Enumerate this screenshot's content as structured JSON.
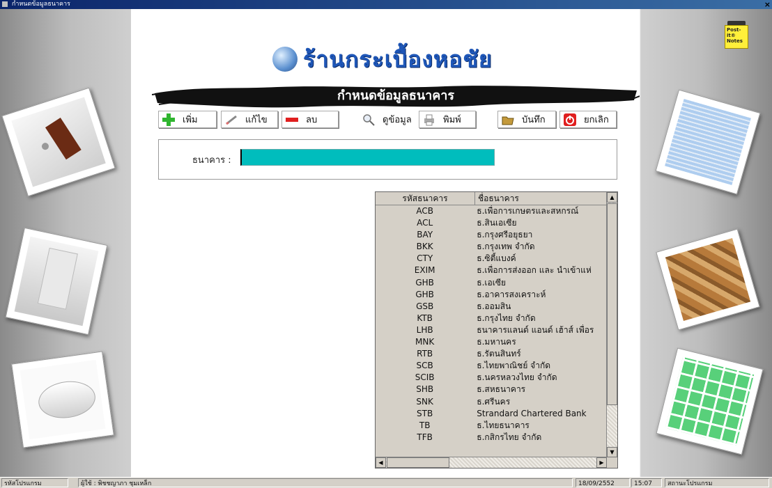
{
  "window": {
    "title": "กำหนดข้อมูลธนาคาร",
    "close_glyph": "×"
  },
  "logo": {
    "shop_name": "ร้านกระเบื้องหอชัย"
  },
  "banner": {
    "title": "กำหนดข้อมูลธนาคาร"
  },
  "toolbar": {
    "add": "เพิ่ม",
    "edit": "แก้ไข",
    "delete": "ลบ",
    "view": "ดูข้อมูล",
    "print": "พิมพ์",
    "save": "บันทึก",
    "cancel": "ยกเลิก"
  },
  "form": {
    "bank_label": "ธนาคาร :",
    "bank_value": ""
  },
  "grid": {
    "columns": [
      "รหัสธนาคาร",
      "ชื่อธนาคาร"
    ],
    "rows": [
      [
        "ACB",
        "ธ.เพื่อการเกษตรและสหกรณ์"
      ],
      [
        "ACL",
        "ธ.สินเอเซีย"
      ],
      [
        "BAY",
        "ธ.กรุงศรีอยุธยา"
      ],
      [
        "BKK",
        "ธ.กรุงเทพ จำกัด"
      ],
      [
        "CTY",
        "ธ.ซิตี้แบงค์"
      ],
      [
        "EXIM",
        "ธ.เพื่อการส่งออก และ นำเข้าแห่"
      ],
      [
        "GHB",
        "ธ.เอเซีย"
      ],
      [
        "GHB",
        "ธ.อาคารสงเคราะห์"
      ],
      [
        "GSB",
        "ธ.ออมสิน"
      ],
      [
        "KTB",
        "ธ.กรุงไทย จำกัด"
      ],
      [
        "LHB",
        "ธนาคารแลนด์ แอนด์ เฮ้าส์ เพื่อร"
      ],
      [
        "MNK",
        "ธ.มหานคร"
      ],
      [
        "RTB",
        "ธ.รัตนสินทร์"
      ],
      [
        "SCB",
        "ธ.ไทยพาณิชย์ จำกัด"
      ],
      [
        "SCIB",
        "ธ.นครหลวงไทย จำกัด"
      ],
      [
        "SHB",
        "ธ.สหธนาคาร"
      ],
      [
        "SNK",
        "ธ.ศรีนคร"
      ],
      [
        "STB",
        "Strandard Chartered Bank"
      ],
      [
        "TB",
        "ธ.ไทยธนาคาร"
      ],
      [
        "TFB",
        "ธ.กสิกรไทย จำกัด"
      ]
    ]
  },
  "postit": {
    "text": "Post-it® Notes"
  },
  "statusbar": {
    "program_code": "รหัสโปรแกรม",
    "user": "ผู้ใช้ : พิชชญาภา ชุมเหล็ก",
    "date": "18/09/2552",
    "time": "15:07",
    "program_status": "สถานะโปรแกรม"
  },
  "colors": {
    "field_fill": "#00bdbd",
    "titlebar_start": "#0a246a",
    "logo_text": "#1f57b8",
    "add_icon": "#2fb52f",
    "delete_icon": "#e01f1f",
    "cancel_icon": "#e01f1f"
  },
  "icons": {
    "add": "plus-icon",
    "edit": "pencil-icon",
    "delete": "minus-icon",
    "view": "magnifier-icon",
    "print": "printer-icon",
    "save": "folder-icon",
    "cancel": "power-icon"
  }
}
